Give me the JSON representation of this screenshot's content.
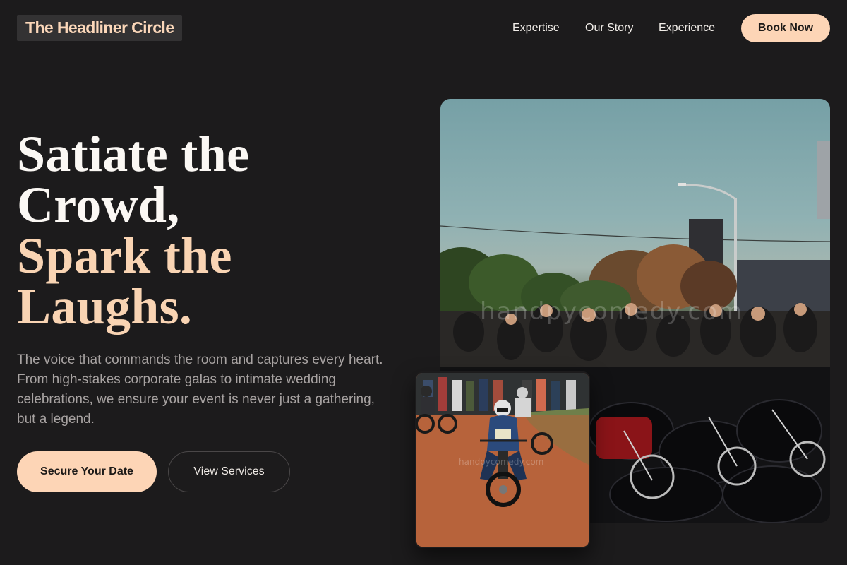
{
  "header": {
    "logo": "The Headliner Circle",
    "nav": [
      "Expertise",
      "Our Story",
      "Experience"
    ],
    "book_label": "Book Now"
  },
  "hero": {
    "headline_lines": [
      "Satiate the",
      "Crowd,",
      "Spark the",
      "Laughs."
    ],
    "description": "The voice that commands the room and captures every heart. From high-stakes corporate galas to intimate wedding celebrations, we ensure your event is never just a gathering, but a legend.",
    "primary_cta": "Secure Your Date",
    "secondary_cta": "View Services"
  },
  "media": {
    "main_watermark": "handpycomedy.com",
    "inset_watermark": "handpycomedy.com"
  },
  "colors": {
    "background": "#1c1b1c",
    "accent": "#fdd5b6",
    "accent_text": "#f9d4b3",
    "muted_text": "#a8a3a2"
  }
}
